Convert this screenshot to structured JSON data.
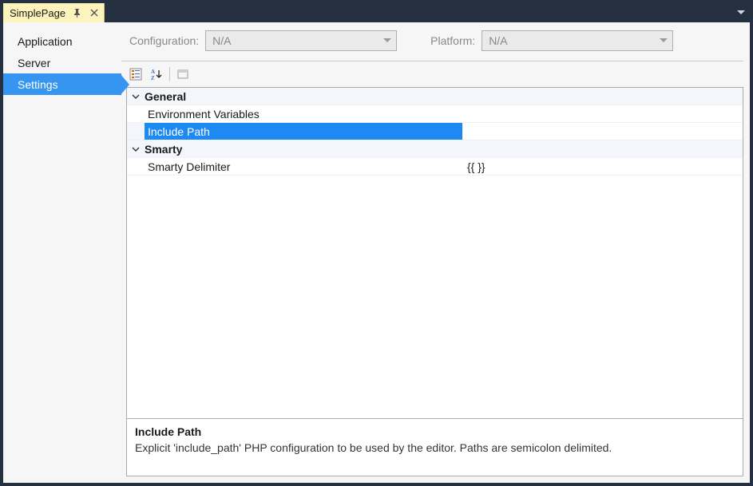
{
  "tab": {
    "title": "SimplePage"
  },
  "sidebar": {
    "items": [
      {
        "label": "Application",
        "selected": false
      },
      {
        "label": "Server",
        "selected": false
      },
      {
        "label": "Settings",
        "selected": true
      }
    ]
  },
  "config": {
    "configuration_label": "Configuration:",
    "configuration_value": "N/A",
    "platform_label": "Platform:",
    "platform_value": "N/A"
  },
  "grid": {
    "categories": [
      {
        "name": "General",
        "expanded": true,
        "props": [
          {
            "name": "Environment Variables",
            "value": "",
            "selected": false
          },
          {
            "name": "Include Path",
            "value": "",
            "selected": true
          }
        ]
      },
      {
        "name": "Smarty",
        "expanded": true,
        "props": [
          {
            "name": "Smarty Delimiter",
            "value": "{{ }}",
            "selected": false
          }
        ]
      }
    ]
  },
  "help": {
    "title": "Include Path",
    "description": "Explicit 'include_path' PHP configuration to be used by the editor. Paths are semicolon delimited."
  }
}
